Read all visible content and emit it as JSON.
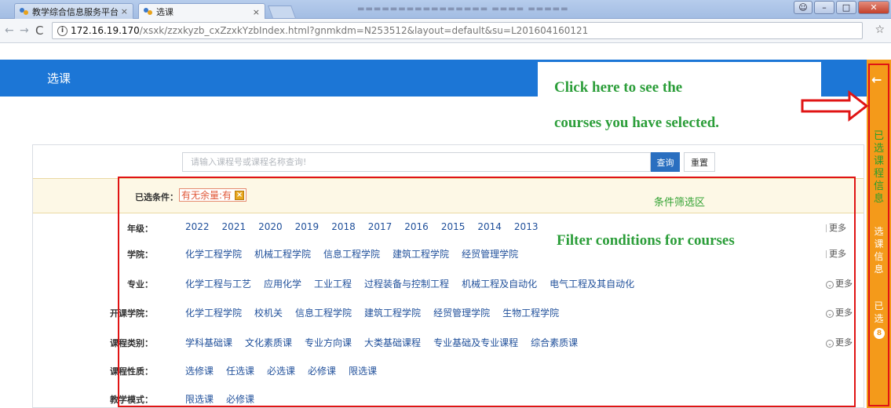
{
  "browser": {
    "tabs": [
      {
        "title": "教学综合信息服务平台"
      },
      {
        "title": "选课"
      }
    ],
    "tab_close_glyph": "×",
    "url_host": "172.16.19.170",
    "url_path": "/xsxk/zzxkyzb_cxZzxkYzbIndex.html?gnmkdm=N253512&layout=default&su=L201604160121"
  },
  "page": {
    "header_title": "选课",
    "search": {
      "placeholder": "请输入课程号或课程名称查询!",
      "query_button": "查询",
      "reset_button": "重置"
    },
    "selected_conditions": {
      "label": "已选条件：",
      "chip": "有无余量:有",
      "zone_label": "条件筛选区"
    },
    "filters": [
      {
        "label": "年级：",
        "options": [
          "2022",
          "2021",
          "2020",
          "2019",
          "2018",
          "2017",
          "2016",
          "2015",
          "2014",
          "2013"
        ],
        "more": "更多"
      },
      {
        "label": "学院：",
        "options": [
          "化学工程学院",
          "机械工程学院",
          "信息工程学院",
          "建筑工程学院",
          "经贸管理学院"
        ],
        "more": "更多"
      },
      {
        "label": "专业：",
        "options": [
          "化学工程与工艺",
          "应用化学",
          "工业工程",
          "过程装备与控制工程",
          "机械工程及自动化",
          "电气工程及其自动化"
        ],
        "more": "更多"
      },
      {
        "label": "开课学院：",
        "options": [
          "化学工程学院",
          "校机关",
          "信息工程学院",
          "建筑工程学院",
          "经贸管理学院",
          "生物工程学院"
        ],
        "more": "更多"
      },
      {
        "label": "课程类别：",
        "options": [
          "学科基础课",
          "文化素质课",
          "专业方向课",
          "大类基础课程",
          "专业基础及专业课程",
          "综合素质课"
        ],
        "more": "更多"
      },
      {
        "label": "课程性质：",
        "options": [
          "选修课",
          "任选课",
          "必选课",
          "必修课",
          "限选课"
        ],
        "more": ""
      },
      {
        "label": "教学模式：",
        "options": [
          "限选课",
          "必修课"
        ],
        "more": ""
      }
    ]
  },
  "sidebar": {
    "arrow": "←",
    "selected_course_info": "已选课程信息",
    "course_info": "选课信息",
    "picked": "已选",
    "picked_count": "8"
  },
  "annotations": {
    "line1": "Click here to see the",
    "line2": "courses you have selected.",
    "filter_note": "Filter conditions for courses"
  },
  "colors": {
    "brand_blue": "#1c76d6",
    "sidebar_orange": "#f49a1a",
    "annotation_green": "#2c9e3a",
    "highlight_red": "#e01414"
  }
}
